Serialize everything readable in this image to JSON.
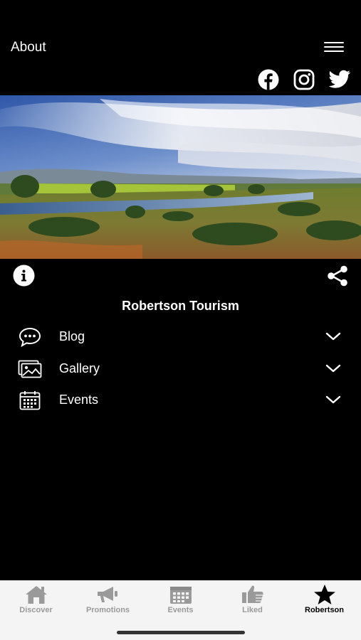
{
  "header": {
    "title": "About",
    "menu_icon": "hamburger-menu-icon"
  },
  "social": [
    {
      "name": "facebook-icon"
    },
    {
      "name": "instagram-icon"
    },
    {
      "name": "twitter-icon"
    }
  ],
  "hero": {
    "image": "landscape-photo"
  },
  "actions": {
    "info_icon": "info-icon",
    "share_icon": "share-icon"
  },
  "org": {
    "name": "Robertson Tourism"
  },
  "sections": [
    {
      "label": "Blog",
      "icon": "chat-bubble-icon"
    },
    {
      "label": "Gallery",
      "icon": "gallery-icon"
    },
    {
      "label": "Events",
      "icon": "calendar-icon"
    }
  ],
  "tabs": [
    {
      "label": "Discover",
      "icon": "home-icon",
      "active": false
    },
    {
      "label": "Promotions",
      "icon": "megaphone-icon",
      "active": false
    },
    {
      "label": "Events",
      "icon": "calendar-icon",
      "active": false
    },
    {
      "label": "Liked",
      "icon": "thumbs-up-icon",
      "active": false
    },
    {
      "label": "Robertson",
      "icon": "star-icon",
      "active": true
    }
  ],
  "colors": {
    "background": "#000000",
    "tab_bar": "#f4f4f4",
    "tab_inactive": "#9a9a9a",
    "tab_active": "#000000"
  }
}
